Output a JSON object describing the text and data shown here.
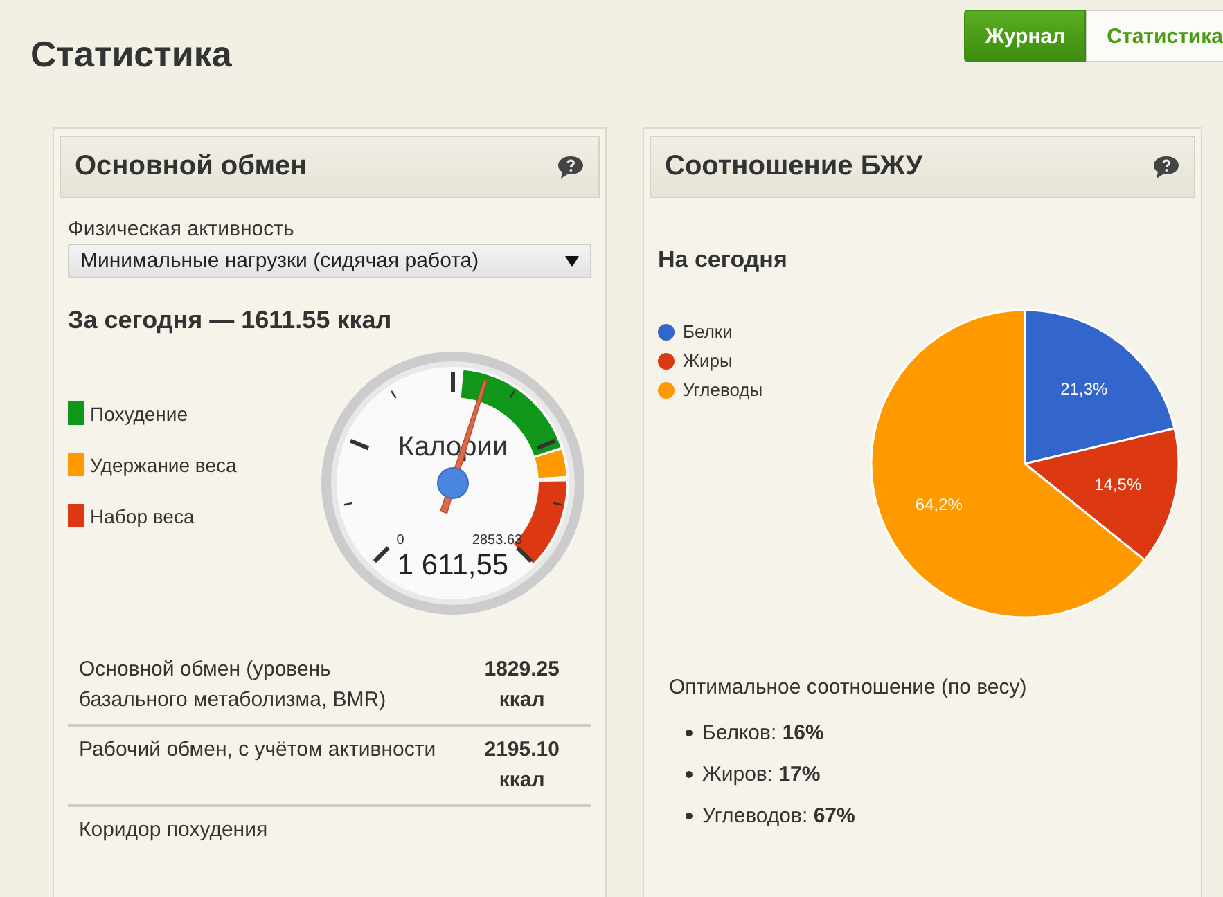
{
  "page_title": "Статистика",
  "tabs": [
    {
      "label": "Журнал",
      "selected": true
    },
    {
      "label": "Статистика",
      "selected": false
    }
  ],
  "bmr_panel": {
    "title": "Основной обмен",
    "activity_label": "Физическая активность",
    "activity_select": "Минимальные нагрузки (сидячая работа)",
    "today": "За сегодня — 1611.55 ккал",
    "legend": [
      {
        "label": "Похудение",
        "color": "#109618"
      },
      {
        "label": "Удержание веса",
        "color": "#ff9900"
      },
      {
        "label": "Набор веса",
        "color": "#dc3912"
      }
    ],
    "gauge": {
      "label": "Калории",
      "min_label": "0",
      "max_label": "2853.63",
      "value_label": "1 611,55",
      "level": 0.565
    },
    "rows": [
      {
        "label": "Основной обмен (уровень базального метаболизма, BMR)",
        "value": "1829.25 ккал"
      },
      {
        "label": "Рабочий обмен, с учётом активности",
        "value": "2195.10 ккал"
      },
      {
        "label": "Коридор похудения"
      }
    ]
  },
  "ratio_panel": {
    "title": "Соотношение БЖУ",
    "subtitle": "На сегодня",
    "chart_data": {
      "type": "pie",
      "categories": [
        "Белки",
        "Жиры",
        "Углеводы"
      ],
      "colors": [
        "#3366cc",
        "#dc3912",
        "#ff9900"
      ],
      "legend": "left",
      "series": [
        {
          "values": [
            21.3,
            14.5,
            64.2
          ]
        }
      ],
      "value_labels": [
        "21,3%",
        "14,5%",
        "64,2%"
      ]
    },
    "optimal_title": "Оптимальное соотношение (по весу)",
    "optimal": [
      "Белков: **16%**",
      "Жиров: **17%**",
      "Углеводов: **67%**"
    ]
  }
}
